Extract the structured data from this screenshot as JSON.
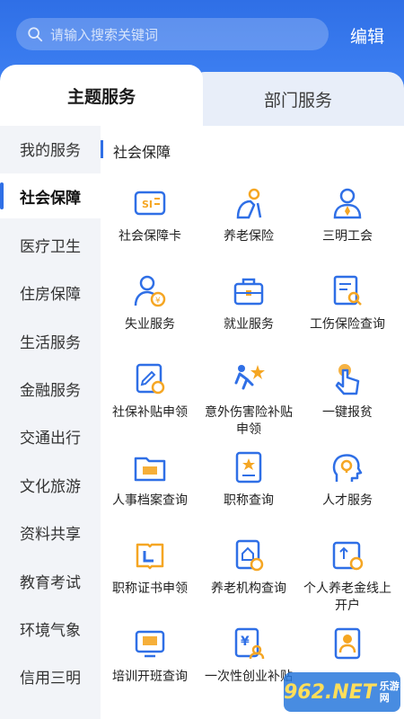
{
  "search": {
    "placeholder": "请输入搜索关键词"
  },
  "header": {
    "edit_label": "编辑"
  },
  "tabs": [
    {
      "label": "主题服务",
      "active": true
    },
    {
      "label": "部门服务",
      "active": false
    }
  ],
  "sidebar": {
    "items": [
      {
        "label": "我的服务"
      },
      {
        "label": "社会保障",
        "active": true
      },
      {
        "label": "医疗卫生"
      },
      {
        "label": "住房保障"
      },
      {
        "label": "生活服务"
      },
      {
        "label": "金融服务"
      },
      {
        "label": "交通出行"
      },
      {
        "label": "文化旅游"
      },
      {
        "label": "资料共享"
      },
      {
        "label": "教育考试"
      },
      {
        "label": "环境气象"
      },
      {
        "label": "信用三明"
      }
    ]
  },
  "section": {
    "title": "社会保障"
  },
  "services": [
    {
      "label": "社会保障卡",
      "icon": "social-security-card-icon"
    },
    {
      "label": "养老保险",
      "icon": "pension-insurance-icon"
    },
    {
      "label": "三明工会",
      "icon": "trade-union-icon"
    },
    {
      "label": "失业服务",
      "icon": "unemployment-service-icon"
    },
    {
      "label": "就业服务",
      "icon": "employment-service-icon"
    },
    {
      "label": "工伤保险查询",
      "icon": "work-injury-query-icon"
    },
    {
      "label": "社保补贴申领",
      "icon": "subsidy-application-icon"
    },
    {
      "label": "意外伤害险补贴申领",
      "icon": "accident-insurance-icon"
    },
    {
      "label": "一键报贫",
      "icon": "one-click-report-icon"
    },
    {
      "label": "人事档案查询",
      "icon": "personnel-archive-icon"
    },
    {
      "label": "职称查询",
      "icon": "professional-title-icon"
    },
    {
      "label": "人才服务",
      "icon": "talent-service-icon"
    },
    {
      "label": "职称证书申领",
      "icon": "title-certificate-icon"
    },
    {
      "label": "养老机构查询",
      "icon": "elderly-care-institution-icon"
    },
    {
      "label": "个人养老金线上开户",
      "icon": "personal-pension-account-icon"
    },
    {
      "label": "培训开班查询",
      "icon": "training-class-icon"
    },
    {
      "label": "一次性创业补贴",
      "icon": "startup-subsidy-icon"
    },
    {
      "label": "",
      "icon": "badge-icon"
    }
  ],
  "watermark": {
    "text": "962.NET",
    "sub": "乐游网"
  },
  "colors": {
    "primary": "#2f6fe6",
    "accent": "#f5a623"
  }
}
